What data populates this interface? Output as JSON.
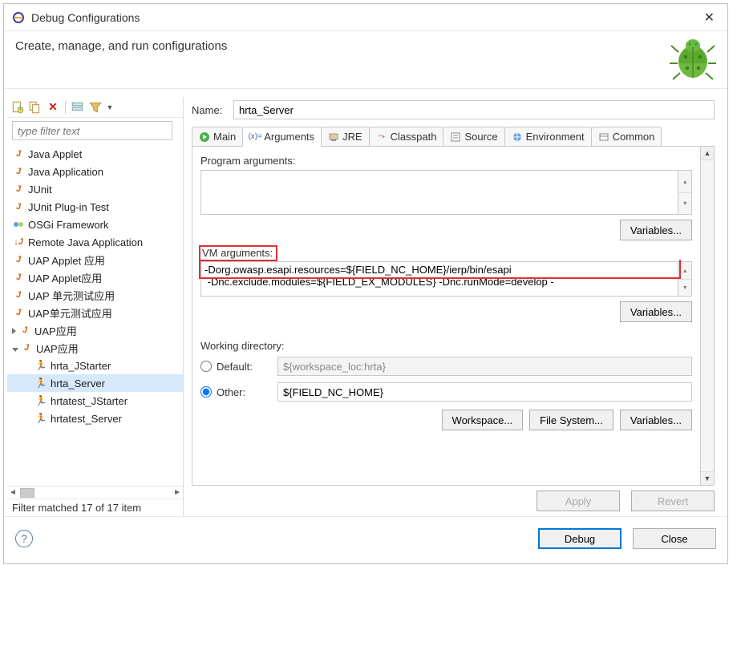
{
  "window": {
    "title": "Debug Configurations"
  },
  "header": {
    "title": "Create, manage, and run configurations"
  },
  "filter": {
    "placeholder": "type filter text",
    "status": "Filter matched 17 of 17 item"
  },
  "tree": {
    "items": [
      {
        "kind": "jicon",
        "label": "Java Applet"
      },
      {
        "kind": "jicon",
        "label": "Java Application"
      },
      {
        "kind": "jicon",
        "label": "JUnit"
      },
      {
        "kind": "jicon",
        "label": "JUnit Plug-in Test"
      },
      {
        "kind": "osgi",
        "label": "OSGi Framework"
      },
      {
        "kind": "down",
        "label": "Remote Java Application"
      },
      {
        "kind": "jicon",
        "label": "UAP Applet 应用"
      },
      {
        "kind": "jicon",
        "label": "UAP Applet应用"
      },
      {
        "kind": "jicon",
        "label": "UAP 单元测试应用"
      },
      {
        "kind": "jicon",
        "label": "UAP单元测试应用"
      },
      {
        "kind": "jicon",
        "label": "UAP应用",
        "caret": "closed"
      },
      {
        "kind": "jicon",
        "label": "UAP应用",
        "caret": "open",
        "expanded": true,
        "children": [
          {
            "label": "hrta_JStarter"
          },
          {
            "label": "hrta_Server",
            "selected": true
          },
          {
            "label": "hrtatest_JStarter"
          },
          {
            "label": "hrtatest_Server"
          }
        ]
      }
    ]
  },
  "name": {
    "label": "Name:",
    "value": "hrta_Server"
  },
  "tabs": {
    "items": [
      {
        "id": "main",
        "label": "Main",
        "icon": "play"
      },
      {
        "id": "arguments",
        "label": "Arguments",
        "icon": "args",
        "active": true
      },
      {
        "id": "jre",
        "label": "JRE",
        "icon": "jre"
      },
      {
        "id": "classpath",
        "label": "Classpath",
        "icon": "cp"
      },
      {
        "id": "source",
        "label": "Source",
        "icon": "src"
      },
      {
        "id": "environment",
        "label": "Environment",
        "icon": "env"
      },
      {
        "id": "common",
        "label": "Common",
        "icon": "common"
      }
    ]
  },
  "args": {
    "program_label": "Program arguments:",
    "program_value": "",
    "vm_label": "VM arguments:",
    "vm_value": "-Dorg.owasp.esapi.resources=${FIELD_NC_HOME}/ierp/bin/esapi\n -Dnc.exclude.modules=${FIELD_EX_MODULES} -Dnc.runMode=develop -",
    "variables_btn": "Variables..."
  },
  "wd": {
    "label": "Working directory:",
    "default_label": "Default:",
    "default_value": "${workspace_loc:hrta}",
    "other_label": "Other:",
    "other_value": "${FIELD_NC_HOME}",
    "workspace_btn": "Workspace...",
    "filesystem_btn": "File System...",
    "variables_btn": "Variables..."
  },
  "buttons": {
    "apply": "Apply",
    "revert": "Revert",
    "debug": "Debug",
    "close": "Close"
  }
}
